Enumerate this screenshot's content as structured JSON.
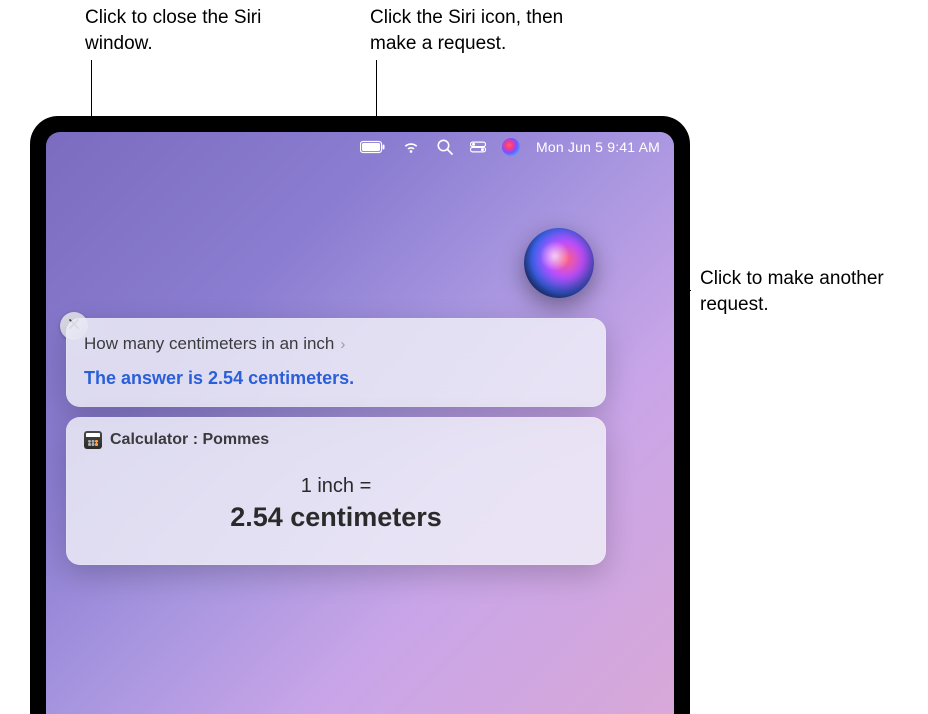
{
  "callouts": {
    "close": "Click to close the Siri window.",
    "menubar": "Click the Siri icon, then make a request.",
    "orb": "Click to make another request."
  },
  "menubar": {
    "clock": "Mon Jun 5  9:41 AM"
  },
  "siri": {
    "query": "How many centimeters in an inch",
    "answer": "The answer is 2.54 centimeters.",
    "source_label": "Calculator : Pommes",
    "eq_line1": "1 inch =",
    "eq_line2": "2.54 centimeters"
  }
}
